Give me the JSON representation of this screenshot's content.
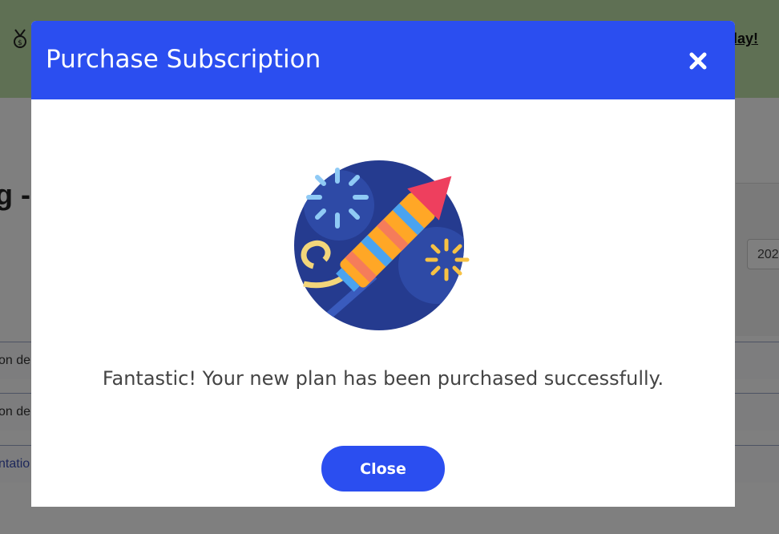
{
  "background": {
    "banner_link": "lay!",
    "heading_fragment": "g -",
    "select_value": "202",
    "separator": "-",
    "rows": [
      "on de",
      "on de",
      "ntatio"
    ]
  },
  "modal": {
    "title": "Purchase Subscription",
    "message": "Fantastic! Your new plan has been purchased successfully.",
    "close_label": "Close",
    "close_icon": "close-x-icon",
    "illustration_icon": "firework-rocket-icon"
  },
  "colors": {
    "primary": "#2b4ef0",
    "banner": "#bfe0a8",
    "overlay": "rgba(0,0,0,0.5)"
  }
}
